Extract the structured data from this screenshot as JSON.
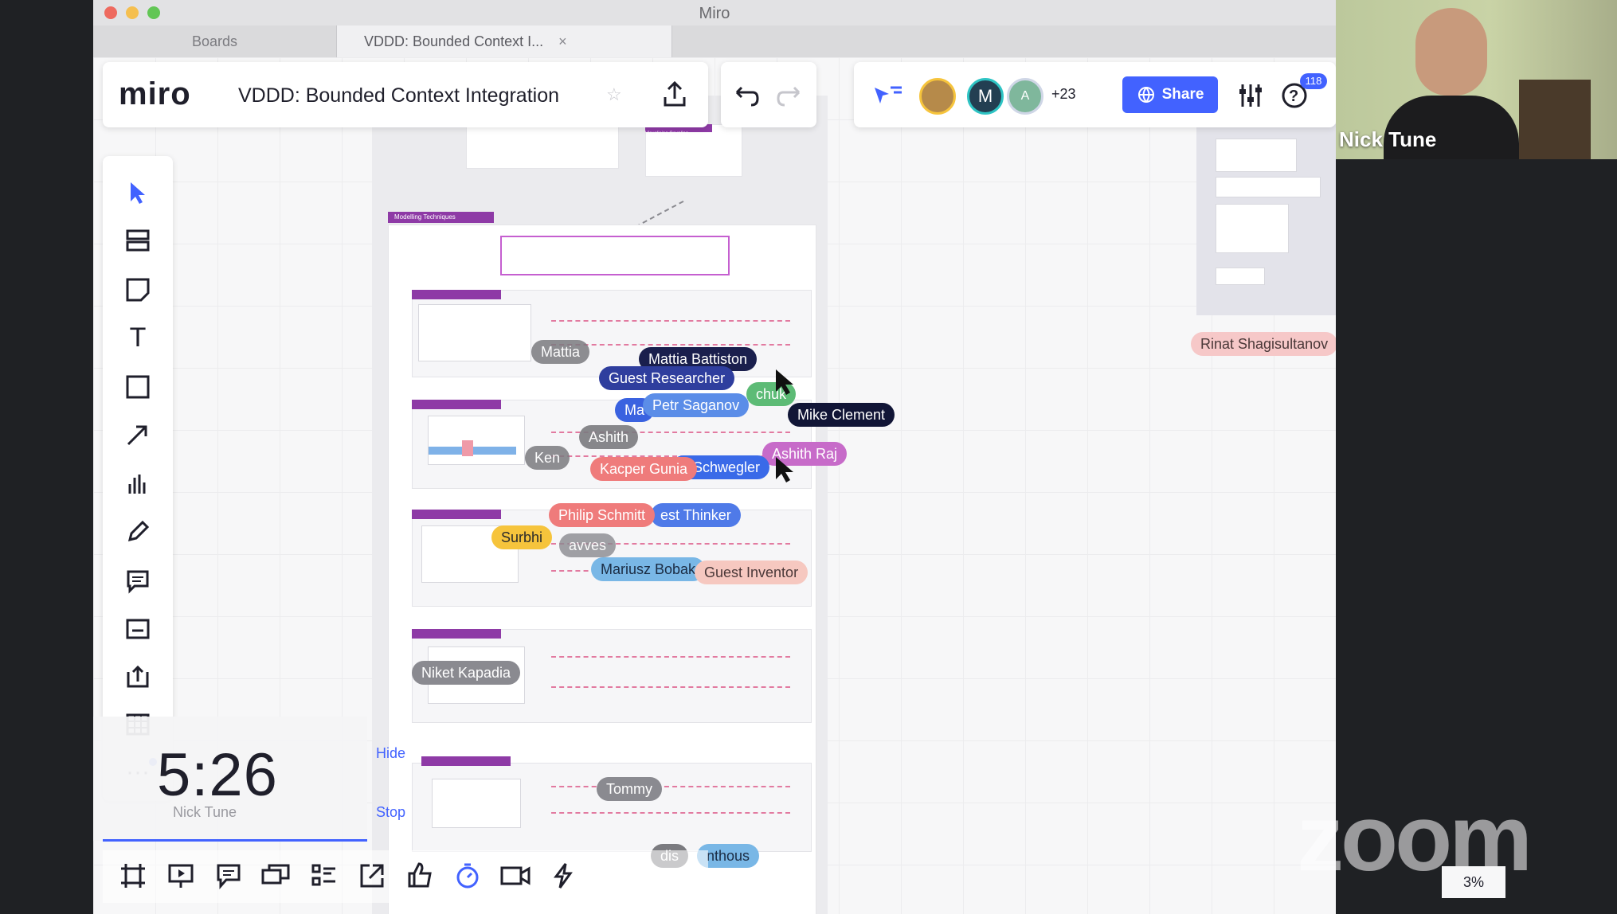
{
  "app": {
    "title": "Miro"
  },
  "tabs": [
    {
      "label": "Boards"
    },
    {
      "label": "VDDD: Bounded Context I..."
    }
  ],
  "board": {
    "logo": "miro",
    "title": "VDDD: Bounded Context Integration",
    "share_label": "Share",
    "collaborators_more": "+23",
    "avatar_m": "M",
    "avatar_a": "A",
    "notifications_count": "118"
  },
  "timer": {
    "display": "5:26",
    "owner": "Nick Tune",
    "hide_label": "Hide",
    "stop_label": "Stop"
  },
  "canvas_text": {
    "frame_title": "Modelling Techniques",
    "frame_title_faded": "Modelling Techniques",
    "sub_tag": "Visualising Coupling"
  },
  "cursors": [
    {
      "name": "Mattia",
      "color": "#7b7b80"
    },
    {
      "name": "Mattia Battiston",
      "color": "#1a1f4d"
    },
    {
      "name": "Guest Researcher",
      "color": "#2f3e9e"
    },
    {
      "name": "Petr Saganov",
      "color": "#5b8de8"
    },
    {
      "name": "Ma",
      "color": "#3a62e0"
    },
    {
      "name": "Mike Clement",
      "color": "#111536"
    },
    {
      "name": "Ashith",
      "color": "#7b7b80"
    },
    {
      "name": "Ashith Raj",
      "color": "#c76bc9"
    },
    {
      "name": "Ken",
      "color": "#7b7b80"
    },
    {
      "name": "Kacper Gunia",
      "color": "#ef7b7b"
    },
    {
      "name": "s-Schwegler",
      "color": "#3a6ae8"
    },
    {
      "name": "Philip Schmitt",
      "color": "#ef7b7b"
    },
    {
      "name": "est Thinker",
      "color": "#4f7ae8"
    },
    {
      "name": "Surbhi",
      "color": "#f6c43c"
    },
    {
      "name": "Mariusz Bobak",
      "color": "#79b7e6"
    },
    {
      "name": "Guest Inventor",
      "color": "#f6c8c0"
    },
    {
      "name": "Niket Kapadia",
      "color": "#8a8a90"
    },
    {
      "name": "Tommy",
      "color": "#8a8a90"
    },
    {
      "name": "Rinat Shagisultanov",
      "color": "#f6c8c8"
    },
    {
      "name": "chuk",
      "color": "#5dbb76"
    },
    {
      "name": "dis",
      "color": "#7b7b80"
    },
    {
      "name": "nthous",
      "color": "#79b7e6"
    },
    {
      "name": "avves",
      "color": "#8a8a90"
    }
  ],
  "presenter": {
    "name": "Nick Tune"
  },
  "zoom": {
    "watermark": "zoom",
    "level": "3%"
  },
  "colors": {
    "accent": "#4262ff",
    "purple": "#8e3aa6"
  }
}
